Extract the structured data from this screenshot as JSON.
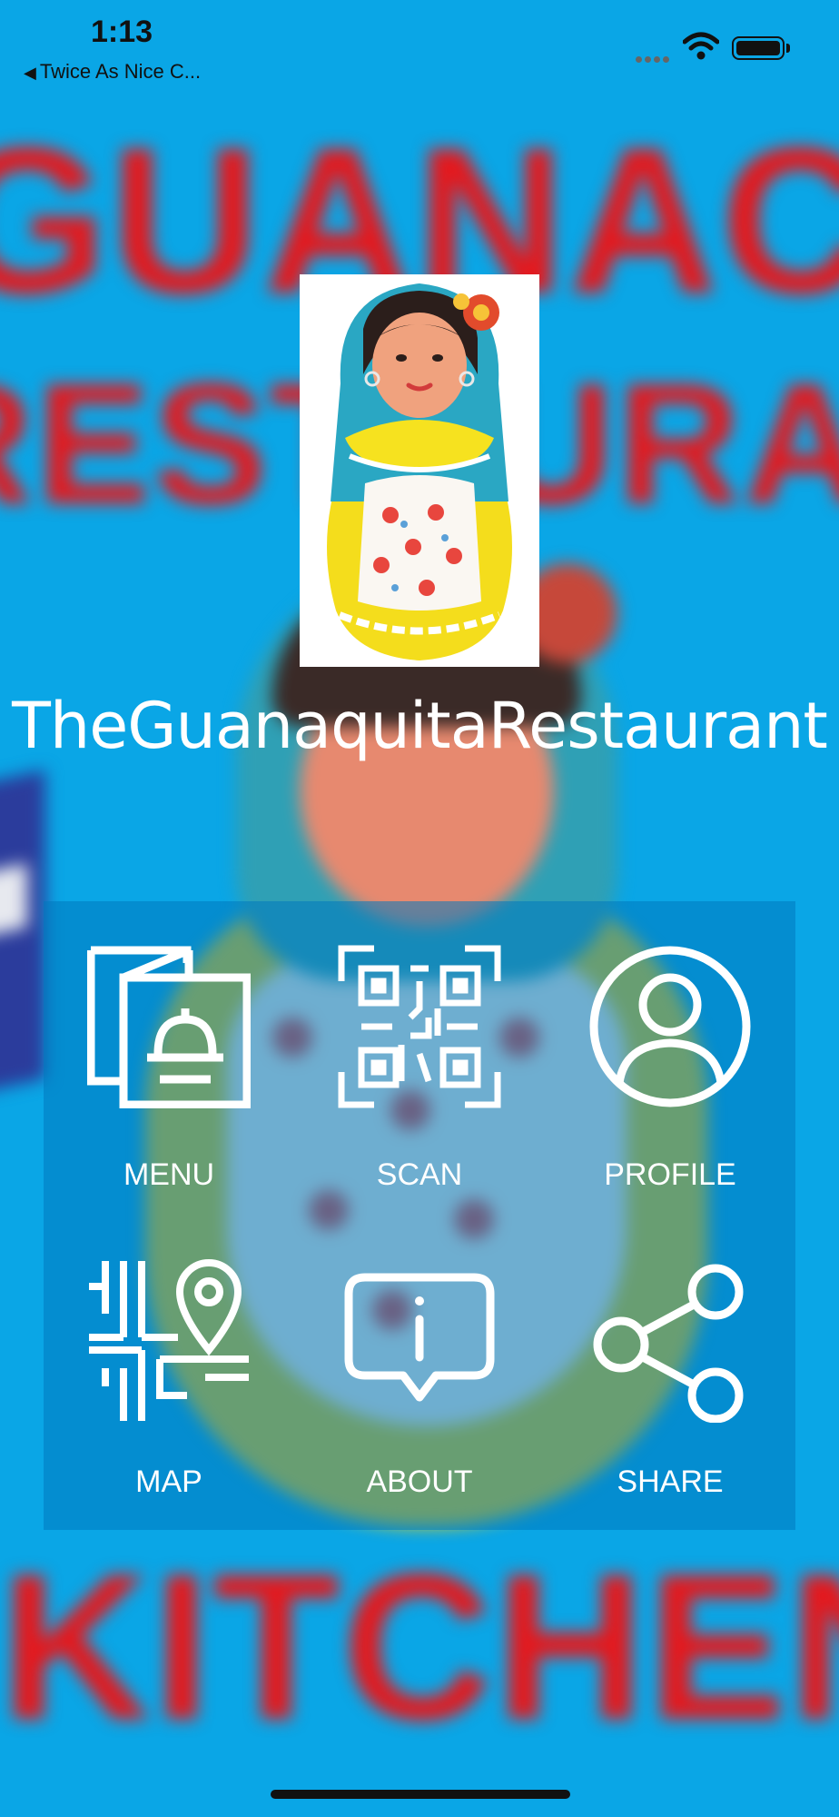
{
  "status_bar": {
    "time": "1:13",
    "back_label": "Twice As Nice C..."
  },
  "background": {
    "words": [
      "GUANAC",
      "RESTAURAN",
      "KITCHENE"
    ],
    "colors": {
      "sky": "#0aa6e6",
      "text": "#e3191e"
    }
  },
  "app": {
    "title": "TheGuanaquitaRestaurant"
  },
  "menu": {
    "items": [
      {
        "label": "MENU",
        "icon": "menu-icon"
      },
      {
        "label": "SCAN",
        "icon": "qr-code-icon"
      },
      {
        "label": "PROFILE",
        "icon": "profile-icon"
      },
      {
        "label": "MAP",
        "icon": "map-pin-icon"
      },
      {
        "label": "ABOUT",
        "icon": "info-bubble-icon"
      },
      {
        "label": "SHARE",
        "icon": "share-icon"
      }
    ]
  }
}
